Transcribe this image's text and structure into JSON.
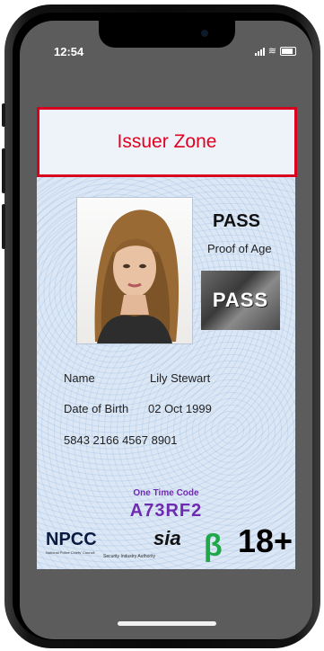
{
  "status_bar": {
    "time": "12:54"
  },
  "card": {
    "issuer_zone": "Issuer Zone",
    "brand": "PASS",
    "subtitle": "Proof of Age",
    "hologram_text": "PASS",
    "name_label": "Name",
    "name_value": "Lily Stewart",
    "dob_label": "Date of Birth",
    "dob_value": "02 Oct 1999",
    "card_number": "5843 2166 4567 8901",
    "one_time_code_label": "One Time Code",
    "one_time_code": "A73RF2",
    "logos": {
      "npcc": "NPCC",
      "npcc_sub": "National Police Chiefs' Council",
      "sia": "sia",
      "sia_sub": "Security Industry Authority",
      "beta": "β",
      "age": "18+"
    }
  },
  "colors": {
    "issuer_border": "#d8001d",
    "code": "#6f2bb0",
    "beta": "#1fa84a"
  }
}
